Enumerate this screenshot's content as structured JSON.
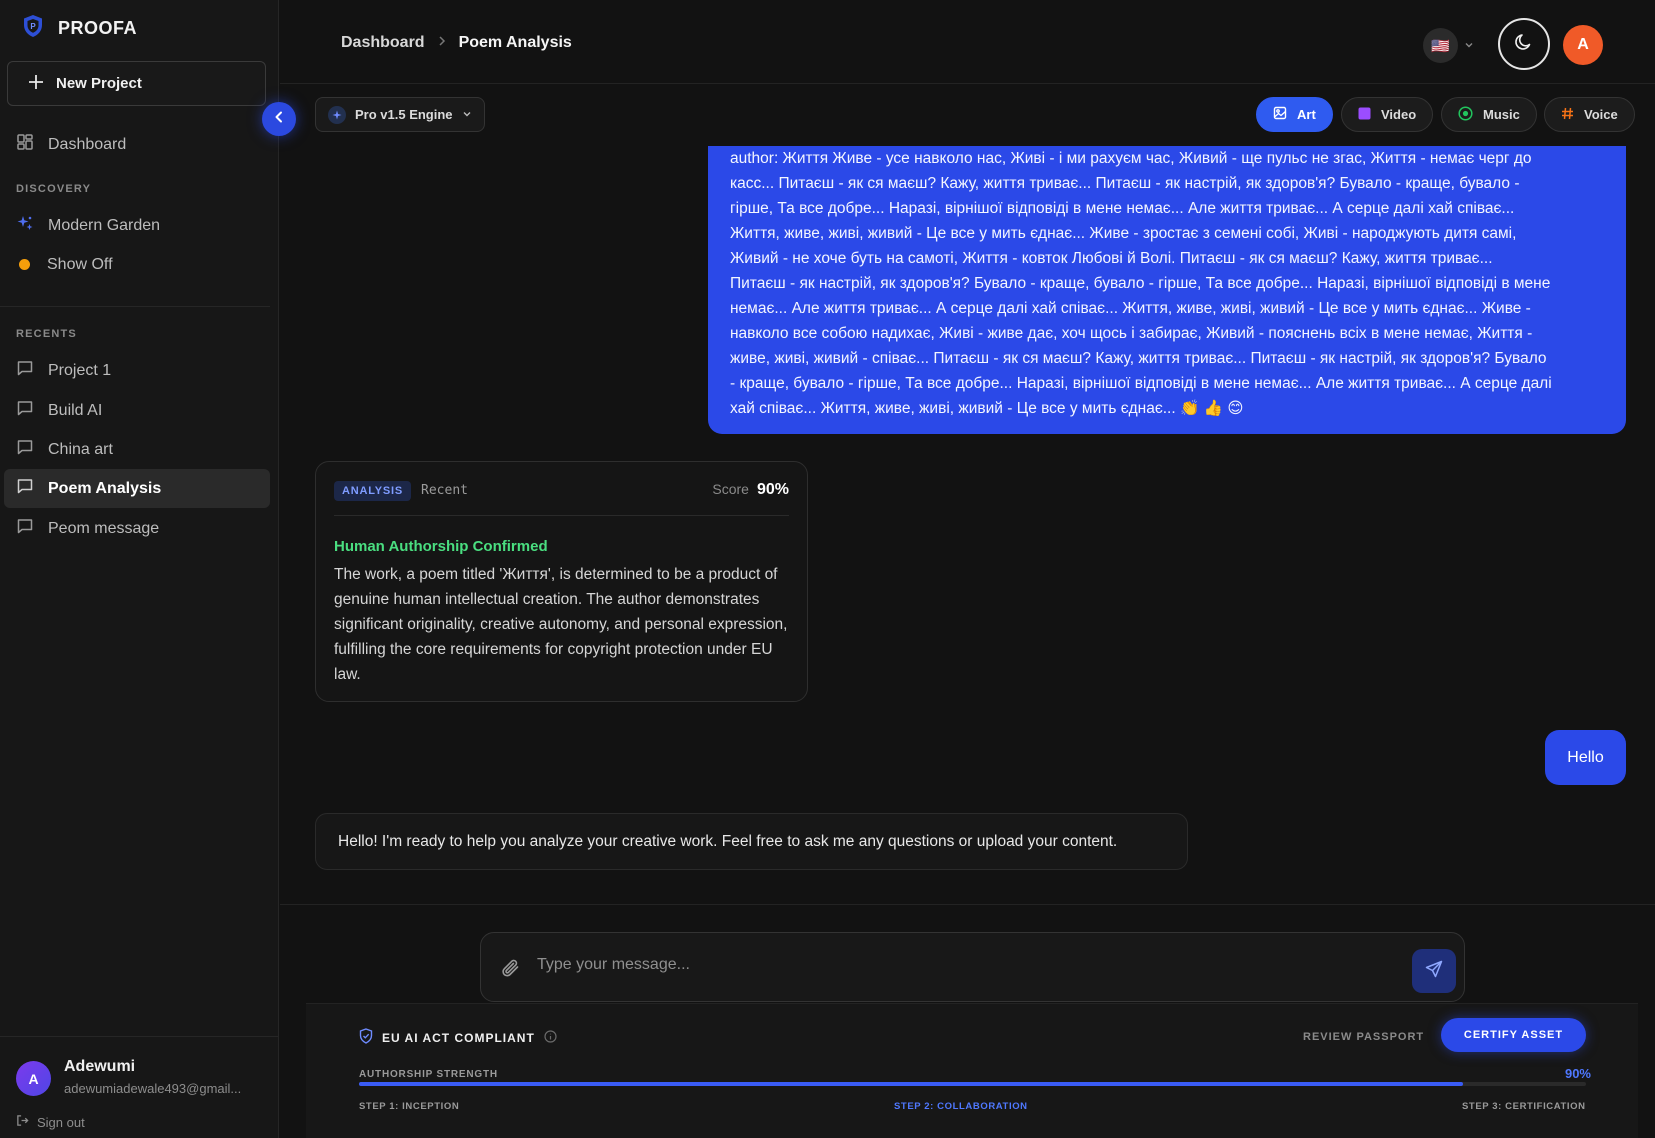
{
  "app": {
    "brand": "PROOFA"
  },
  "sidebar": {
    "new_project": "New Project",
    "dashboard": "Dashboard",
    "discovery_label": "DISCOVERY",
    "discovery_items": [
      "Modern Garden",
      "Show Off"
    ],
    "recents_label": "RECENTS",
    "recents": [
      "Project 1",
      "Build AI",
      "China art",
      "Poem Analysis",
      "Peom message"
    ],
    "active_recent": "Poem Analysis",
    "user": {
      "initial": "A",
      "name": "Adewumi",
      "email": "adewumiadewale493@gmail..."
    },
    "sign_out": "Sign out"
  },
  "header": {
    "breadcrumb": [
      "Dashboard",
      "Poem Analysis"
    ],
    "flag": "🇺🇸",
    "avatar_initial": "A"
  },
  "toolbar": {
    "engine": "Pro v1.5 Engine",
    "modes": [
      "Art",
      "Video",
      "Music",
      "Voice"
    ],
    "active_mode": "Art"
  },
  "chat": {
    "user_poem_lines": [
      "author: Життя Живе - усе навколо нас, Живі - і ми рахуєм час, Живий - ще пульс не згас, Життя - немає черг до",
      "касс... Питаєш - як ся маєш? Кажу, життя триває... Питаєш - як настрій, як здоров'я? Бувало - краще, бувало -",
      "гірше, Та все добре... Наразі, вірнішої відповіді в мене немає... Але життя триває... А серце далі хай співає...",
      "Життя, живе, живі, живий - Це все у мить єднає... Живе - зростає з семені собі, Живі - народжують дитя самі,",
      "Живий - не хоче буть на самоті, Життя - ковток Любові й Волі. Питаєш - як ся маєш? Кажу, життя триває...",
      "Питаєш - як настрій, як здоров'я? Бувало - краще, бувало - гірше, Та все добре... Наразі, вірнішої відповіді в мене",
      "немає... Але життя триває... А серце далі хай співає... Життя, живе, живі, живий - Це все у мить єднає... Живе -",
      "навколо все собою надихає, Живі - живе дає, хоч щось і забирає, Живий - пояснень всіх в мене немає, Життя -",
      "живе, живі, живий - співає... Питаєш - як ся маєш? Кажу, життя триває... Питаєш - як настрій, як здоров'я? Бувало",
      "- краще, бувало - гірше, Та все добре... Наразі, вірнішої відповіді в мене немає... Але життя триває... А серце далі",
      "хай співає... Життя, живе, живі, живий - Це все у мить єднає... 👏 👍 😊"
    ],
    "analysis": {
      "badge": "ANALYSIS",
      "tag": "Recent",
      "score_label": "Score",
      "score": "90%",
      "title": "Human Authorship Confirmed",
      "body": "The work, a poem titled 'Життя', is determined to be a product of genuine human intellectual creation. The author demonstrates significant originality, creative autonomy, and personal expression, fulfilling the core requirements for copyright protection under EU law."
    },
    "user_hello": "Hello",
    "bot_reply": "Hello! I'm ready to help you analyze your creative work. Feel free to ask me any questions or upload your content."
  },
  "composer": {
    "placeholder": "Type your message..."
  },
  "compliance": {
    "status": "EU AI ACT COMPLIANT",
    "review": "REVIEW PASSPORT",
    "certify": "CERTIFY ASSET",
    "strength_label": "AUTHORSHIP STRENGTH",
    "strength_value": "90%",
    "strength_fraction": 0.9,
    "steps": [
      "STEP 1: INCEPTION",
      "STEP 2: COLLABORATION",
      "STEP 3: CERTIFICATION"
    ],
    "active_step": 2
  },
  "colors": {
    "accent": "#2b49e8",
    "success": "#4ade80",
    "avatar_top": "#f05a28"
  }
}
